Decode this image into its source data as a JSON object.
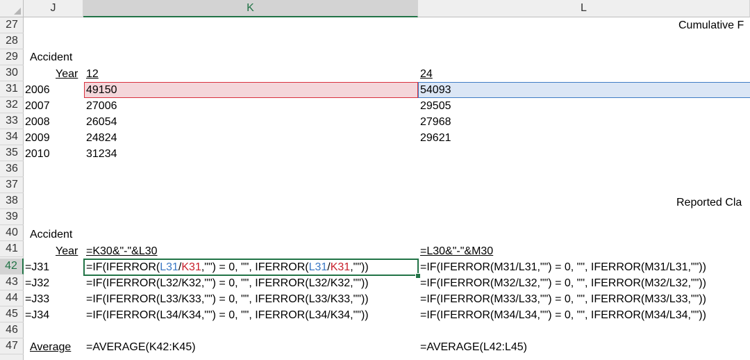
{
  "columns": [
    {
      "label": "J"
    },
    {
      "label": "K"
    },
    {
      "label": "L"
    }
  ],
  "rows": [
    "27",
    "28",
    "29",
    "30",
    "31",
    "32",
    "33",
    "34",
    "35",
    "36",
    "37",
    "38",
    "39",
    "40",
    "41",
    "42",
    "43",
    "44",
    "45",
    "46",
    "47"
  ],
  "sheet": {
    "r27": {
      "l": "Cumulative F"
    },
    "r29": {
      "j": "Accident"
    },
    "r30": {
      "j": "Year",
      "k": "12",
      "l": "24"
    },
    "r31": {
      "j": "2006",
      "k": "49150",
      "l": "54093"
    },
    "r32": {
      "j": "2007",
      "k": "27006",
      "l": "29505"
    },
    "r33": {
      "j": "2008",
      "k": "26054",
      "l": "27968"
    },
    "r34": {
      "j": "2009",
      "k": "24824",
      "l": "29621"
    },
    "r35": {
      "j": "2010",
      "k": "31234"
    },
    "r38": {
      "l": "Reported Cla"
    },
    "r40": {
      "j": "Accident"
    },
    "r41": {
      "j": "Year",
      "k": "=K30&\"-\"&L30",
      "l": "=L30&\"-\"&M30"
    },
    "r42": {
      "j": "=J31",
      "k_parts": [
        "=IF(IFERROR(",
        "L31",
        "/",
        "K31",
        ",\"\") = 0, \"\", IFERROR(",
        "L31",
        "/",
        "K31",
        ",\"\"))"
      ],
      "l": "=IF(IFERROR(M31/L31,\"\") = 0, \"\", IFERROR(M31/L31,\"\"))"
    },
    "r43": {
      "j": "=J32",
      "k": "=IF(IFERROR(L32/K32,\"\") = 0, \"\", IFERROR(L32/K32,\"\"))",
      "l": "=IF(IFERROR(M32/L32,\"\") = 0, \"\", IFERROR(M32/L32,\"\"))"
    },
    "r44": {
      "j": "=J33",
      "k": "=IF(IFERROR(L33/K33,\"\") = 0, \"\", IFERROR(L33/K33,\"\"))",
      "l": "=IF(IFERROR(M33/L33,\"\") = 0, \"\", IFERROR(M33/L33,\"\"))"
    },
    "r45": {
      "j": "=J34",
      "k": "=IF(IFERROR(L34/K34,\"\") = 0, \"\", IFERROR(L34/K34,\"\"))",
      "l": "=IF(IFERROR(M34/L34,\"\") = 0, \"\", IFERROR(M34/L34,\"\"))"
    },
    "r47": {
      "j": "Average",
      "k": "=AVERAGE(K42:K45)",
      "l": "=AVERAGE(L42:L45)"
    }
  },
  "colors": {
    "accent": "#217346",
    "ref_blue": "#3b78c4",
    "ref_red": "#c8202c",
    "hl_red_fill": "#f4d6da",
    "hl_blue_fill": "#dbe6f5"
  }
}
